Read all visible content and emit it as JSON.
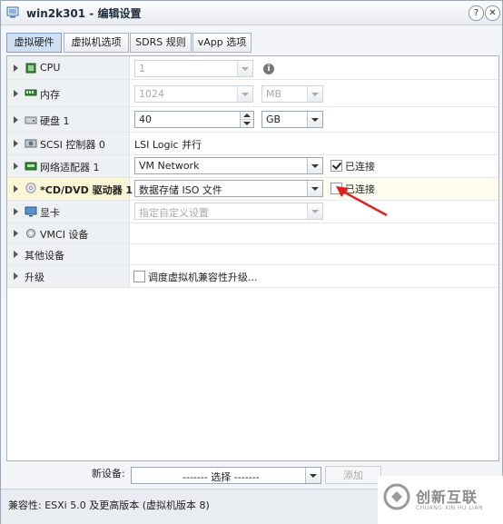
{
  "window": {
    "title": "win2k301 - 编辑设置",
    "help_label": "?",
    "close_label": "✕"
  },
  "tabs": [
    {
      "label": "虚拟硬件",
      "active": true
    },
    {
      "label": "虚拟机选项",
      "active": false
    },
    {
      "label": "SDRS 规则",
      "active": false
    },
    {
      "label": "vApp 选项",
      "active": false
    }
  ],
  "hardware": {
    "cpu": {
      "label": "CPU",
      "value": "1",
      "icon": "cpu-chip-icon"
    },
    "memory": {
      "label": "内存",
      "value": "1024",
      "unit": "MB",
      "icon": "memory-module-icon"
    },
    "disk": {
      "label": "硬盘 1",
      "value": "40",
      "unit": "GB",
      "icon": "hard-disk-icon"
    },
    "scsi": {
      "label": "SCSI 控制器 0",
      "value": "LSI Logic 并行",
      "icon": "scsi-controller-icon"
    },
    "network": {
      "label": "网络适配器 1",
      "value": "VM Network",
      "connected_label": "已连接",
      "connected": true,
      "icon": "network-adapter-icon"
    },
    "cddvd": {
      "label": "*CD/DVD 驱动器 1",
      "value": "数据存储 ISO 文件",
      "connected_label": "已连接",
      "connected": false,
      "icon": "cd-dvd-icon"
    },
    "video": {
      "label": "显卡",
      "value": "指定自定义设置",
      "icon": "monitor-icon"
    },
    "vmci": {
      "label": "VMCI 设备",
      "icon": "gear-device-icon"
    },
    "other": {
      "label": "其他设备"
    },
    "upgrade": {
      "label": "升级",
      "option_label": "调度虚拟机兼容性升级..."
    }
  },
  "new_device": {
    "label": "新设备:",
    "select_value": "------- 选择 -------",
    "add_label": "添加"
  },
  "footer": {
    "compat_text": "兼容性: ESXi 5.0 及更高版本 (虚拟机版本 8)"
  },
  "watermark": {
    "title": "创新互联",
    "subtitle": "CHUANG XIN HU LIAN"
  },
  "colors": {
    "selected_row": "#fbf6d6",
    "label_column": "#eef1f4",
    "annotation_arrow": "#e02020"
  }
}
